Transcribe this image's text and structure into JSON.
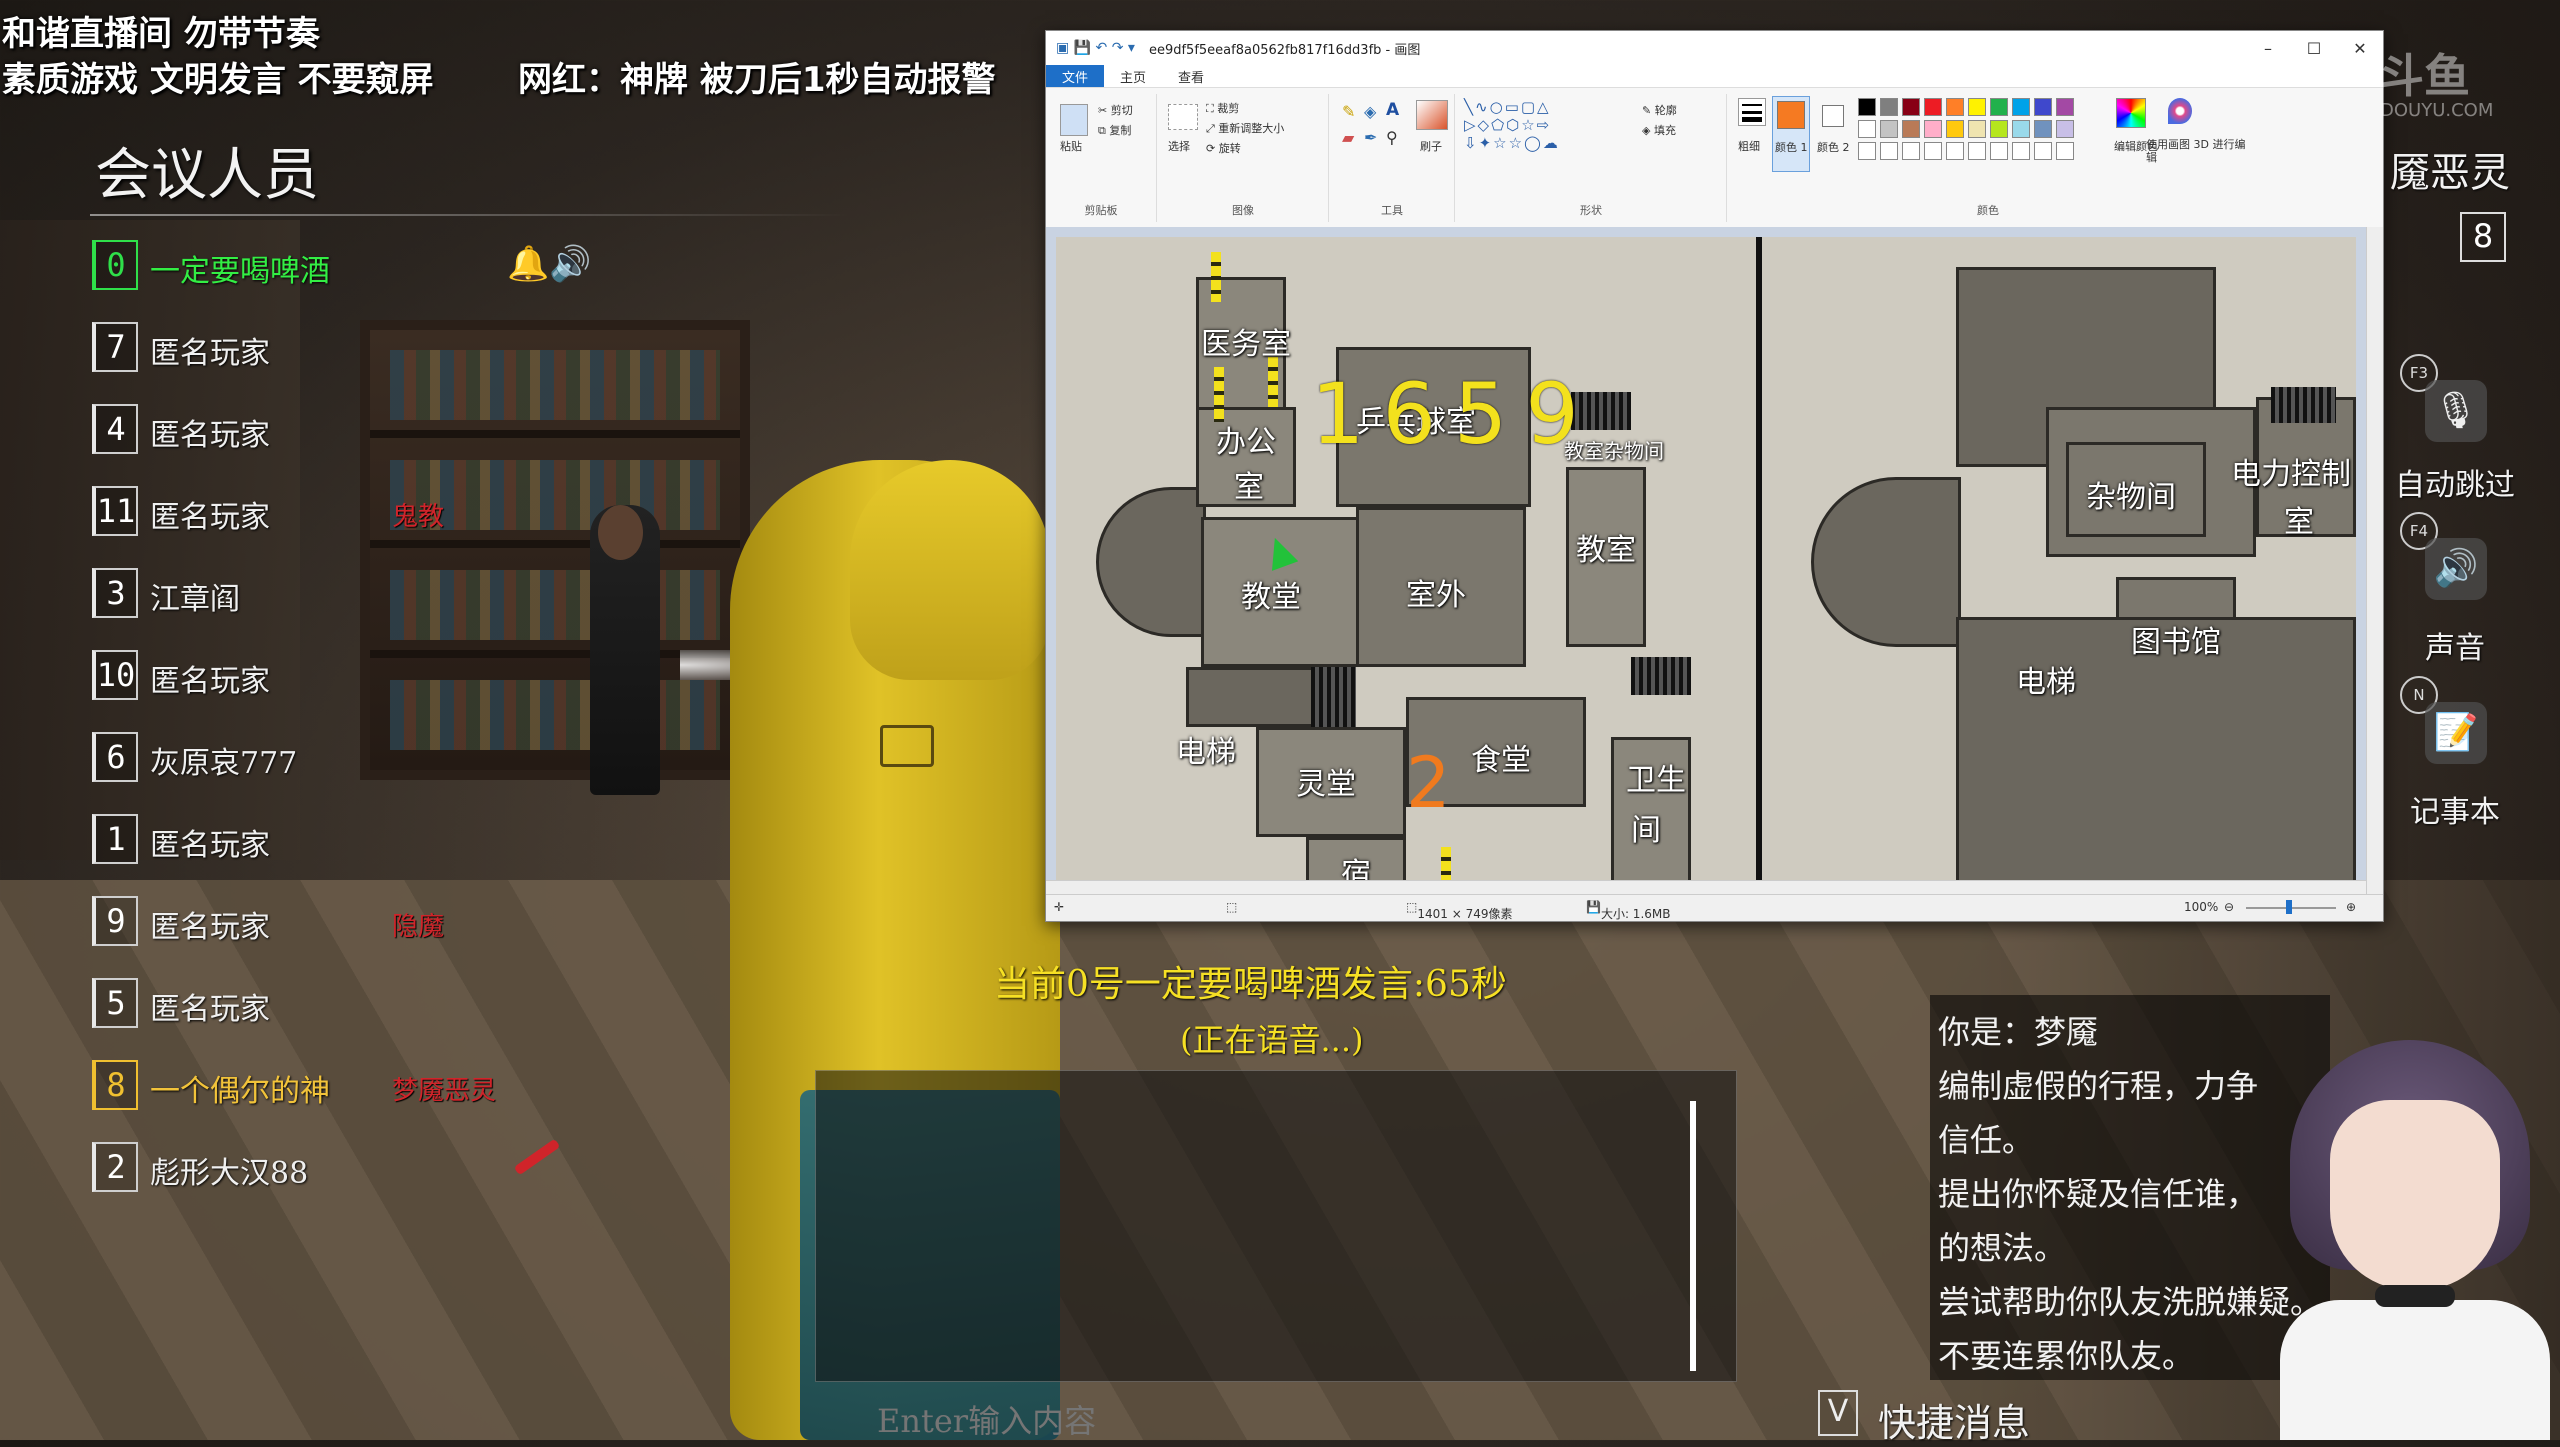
{
  "overlay": {
    "line1": "和谐直播间 勿带节奏",
    "line2": "素质游戏 文明发言 不要窥屏",
    "line3": "网红：神牌 被刀后1秒自动报警"
  },
  "roster": {
    "title": "会议人员",
    "players": [
      {
        "seat": "0",
        "name": "一定要喝啤酒",
        "role": "",
        "color": "green"
      },
      {
        "seat": "7",
        "name": "匿名玩家",
        "role": ""
      },
      {
        "seat": "4",
        "name": "匿名玩家",
        "role": ""
      },
      {
        "seat": "11",
        "name": "匿名玩家",
        "role": "鬼教"
      },
      {
        "seat": "3",
        "name": "江章阎",
        "role": ""
      },
      {
        "seat": "10",
        "name": "匿名玩家",
        "role": ""
      },
      {
        "seat": "6",
        "name": "灰原哀777",
        "role": ""
      },
      {
        "seat": "1",
        "name": "匿名玩家",
        "role": ""
      },
      {
        "seat": "9",
        "name": "匿名玩家",
        "role": "隐魔"
      },
      {
        "seat": "5",
        "name": "匿名玩家",
        "role": ""
      },
      {
        "seat": "8",
        "name": "一个偶尔的神",
        "role": "梦魇恶灵",
        "color": "gold"
      },
      {
        "seat": "2",
        "name": "彪形大汉88",
        "role": ""
      }
    ],
    "speaker_icons": "🔔🔊"
  },
  "paint": {
    "title": "ee9df5f5eeaf8a0562fb817f16dd3fb - 画图",
    "tabs": [
      "文件",
      "主页",
      "查看"
    ],
    "groups": {
      "clipboard": "剪贴板",
      "image": "图像",
      "tools": "工具",
      "shapes": "形状",
      "colors": "颜色"
    },
    "items": {
      "paste": "粘贴",
      "cut": "剪切",
      "copy": "复制",
      "select": "选择",
      "crop": "裁剪",
      "resize": "重新调整大小",
      "rotate": "旋转",
      "brushes": "刷子",
      "outline": "轮廓",
      "fill": "填充",
      "size": "粗细",
      "color1": "颜色 1",
      "color2": "颜色 2",
      "edit_colors": "编辑颜色",
      "paint3d": "使用画图 3D 进行编辑"
    },
    "palette": [
      "#000000",
      "#7f7f7f",
      "#880015",
      "#ed1c24",
      "#ff7f27",
      "#fff200",
      "#22b14c",
      "#00a2e8",
      "#3f48cc",
      "#a349a4",
      "#ffffff",
      "#c3c3c3",
      "#b97a57",
      "#ffaec9",
      "#ffc90e",
      "#efe4b0",
      "#b5e61d",
      "#99d9ea",
      "#7092be",
      "#c8bfe7"
    ],
    "color1": "#f57a22",
    "color2": "#ffffff",
    "status": {
      "dimensions": "1401 × 749像素",
      "size": "大小: 1.6MB",
      "zoom": "100%"
    }
  },
  "map": {
    "drawn_number": "1659",
    "drawn_two": "2",
    "left_rooms": {
      "clinic": "医务室",
      "pingpong": "乒乓球室",
      "office1": "办公",
      "office2": "室",
      "storage": "教室杂物间",
      "classroom": "教室",
      "chapel": "教堂",
      "outside": "室外",
      "elevator": "电梯",
      "spirit_hall": "灵堂",
      "canteen": "食堂",
      "toilet1": "卫生",
      "toilet2": "间",
      "dorm": "宿"
    },
    "right_rooms": {
      "storage": "杂物间",
      "power1": "电力控制",
      "power2": "室",
      "library": "图书馆",
      "elevator": "电梯"
    }
  },
  "speaking": {
    "line": "当前0号一定要喝啤酒发言:65秒",
    "sub": "(正在语音...)"
  },
  "chat": {
    "placeholder": "Enter输入内容"
  },
  "role_card": {
    "lines": [
      "你是：梦魇",
      "编制虚假的行程，力争",
      "信任。",
      "提出你怀疑及信任谁，",
      "的想法。",
      "尝试帮助你队友洗脱嫌疑。",
      "不要连累你队友。"
    ]
  },
  "quick_msg": {
    "key": "V",
    "label": "快捷消息"
  },
  "right": {
    "watermark": "斗鱼",
    "watermark_sub": "DOUYU.COM",
    "my_role": "魇恶灵",
    "my_seat": "8",
    "controls": [
      {
        "key": "F3",
        "icon": "🎙",
        "label": "自动跳过"
      },
      {
        "key": "F4",
        "icon": "🔊",
        "label": "声音"
      },
      {
        "key": "N",
        "icon": "📝",
        "label": "记事本"
      }
    ]
  }
}
